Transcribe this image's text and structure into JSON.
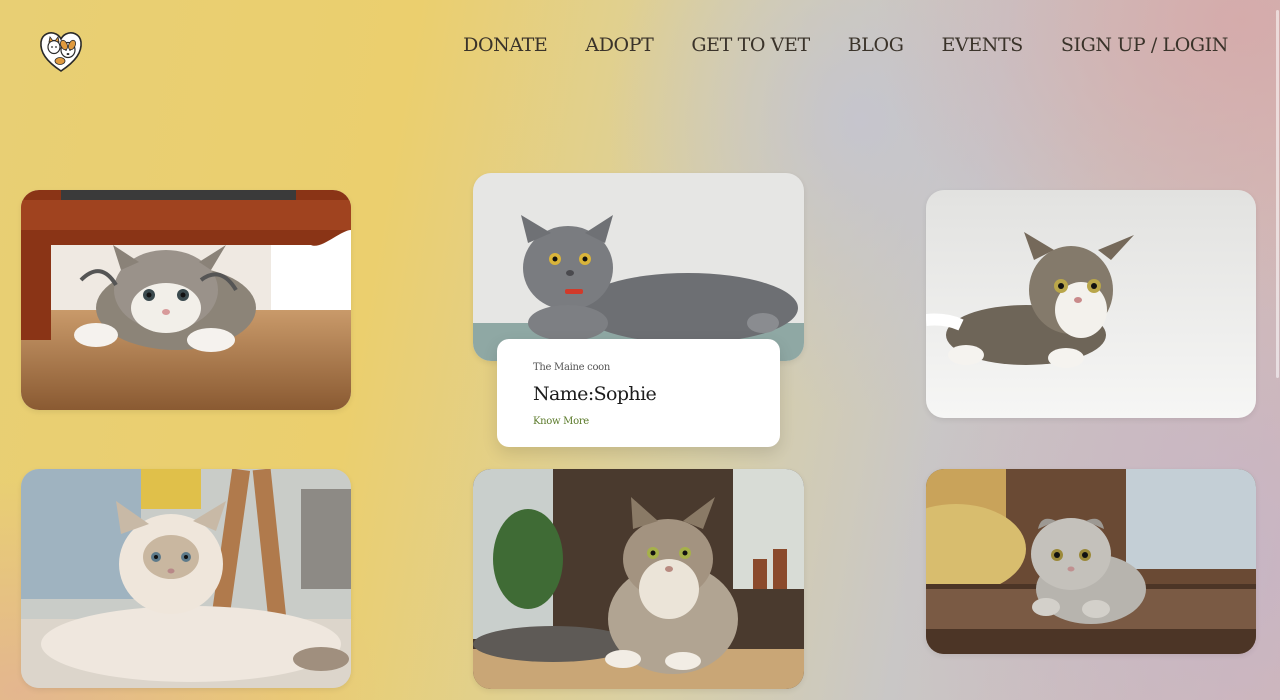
{
  "header": {
    "logo_icon": "heart-cat-dog-logo-icon",
    "nav": [
      {
        "label": "DONATE"
      },
      {
        "label": "ADOPT"
      },
      {
        "label": "GET TO VET"
      },
      {
        "label": "BLOG"
      },
      {
        "label": "EVENTS"
      },
      {
        "label": "SIGN UP / LOGIN"
      }
    ]
  },
  "gallery": {
    "cards": [
      {
        "photo": "tabby-kitten-under-chair"
      },
      {
        "photo": "grey-british-shorthair-cat"
      },
      {
        "photo": "tabby-white-cat-lying"
      },
      {
        "photo": "fluffy-cream-cat-lying"
      },
      {
        "photo": "maine-coon-cat-sitting"
      },
      {
        "photo": "grey-scottish-fold-kitten"
      }
    ],
    "featured": {
      "breed": "The Maine coon",
      "name": "Name:Sophie",
      "link": "Know More"
    }
  },
  "colors": {
    "text": "#3a332a",
    "link": "#5b7a2a",
    "background_left": "#e8cf74",
    "background_right": "#d4b7b4"
  }
}
